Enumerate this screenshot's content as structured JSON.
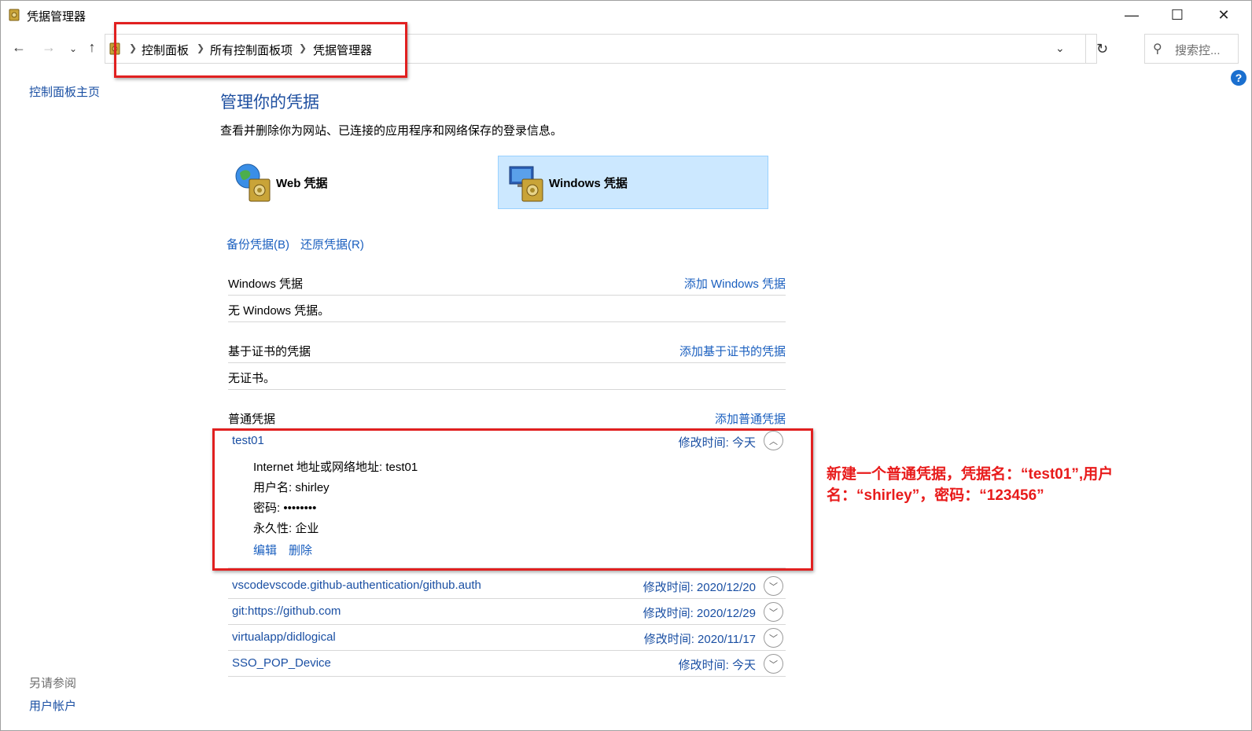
{
  "window": {
    "title": "凭据管理器",
    "minimize": "—",
    "maximize": "☐",
    "close": "✕"
  },
  "nav": {
    "back": "←",
    "forward": "→",
    "recent": "⌄",
    "up": "↑"
  },
  "breadcrumb": {
    "items": [
      "控制面板",
      "所有控制面板项",
      "凭据管理器"
    ]
  },
  "search": {
    "placeholder": "搜索控..."
  },
  "sidebar": {
    "home_link": "控制面板主页",
    "see_also": "另请参阅",
    "user_accounts": "用户帐户"
  },
  "main": {
    "title": "管理你的凭据",
    "description": "查看并删除你为网站、已连接的应用程序和网络保存的登录信息。",
    "web_credentials": "Web 凭据",
    "windows_credentials": "Windows 凭据",
    "backup": "备份凭据(B)",
    "restore": "还原凭据(R)"
  },
  "sections": {
    "windows": {
      "name": "Windows 凭据",
      "add": "添加 Windows 凭据",
      "empty": "无 Windows 凭据。"
    },
    "certificate": {
      "name": "基于证书的凭据",
      "add": "添加基于证书的凭据",
      "empty": "无证书。"
    },
    "generic": {
      "name": "普通凭据",
      "add": "添加普通凭据"
    }
  },
  "generic_credentials": [
    {
      "name": "test01",
      "modified": "修改时间:  今天",
      "details": {
        "address": "Internet 地址或网络地址:  test01",
        "username": "用户名:  shirley",
        "password": "密码:  ••••••••",
        "persistence": "永久性:  企业"
      },
      "edit": "编辑",
      "delete": "删除"
    },
    {
      "name": "vscodevscode.github-authentication/github.auth",
      "modified": "修改时间:  2020/12/20"
    },
    {
      "name": "git:https://github.com",
      "modified": "修改时间:  2020/12/29"
    },
    {
      "name": "virtualapp/didlogical",
      "modified": "修改时间:  2020/11/17"
    },
    {
      "name": "SSO_POP_Device",
      "modified": "修改时间:  今天"
    }
  ],
  "annotation": {
    "text": "新建一个普通凭据，凭据名：“test01”,用户名：“shirley”，密码：“123456”",
    "color": "#e81b1b"
  },
  "colors": {
    "link": "#1a5fbf",
    "title": "#1e4fa0",
    "selected_tile": "#cce8ff",
    "highlight": "#e12020"
  }
}
